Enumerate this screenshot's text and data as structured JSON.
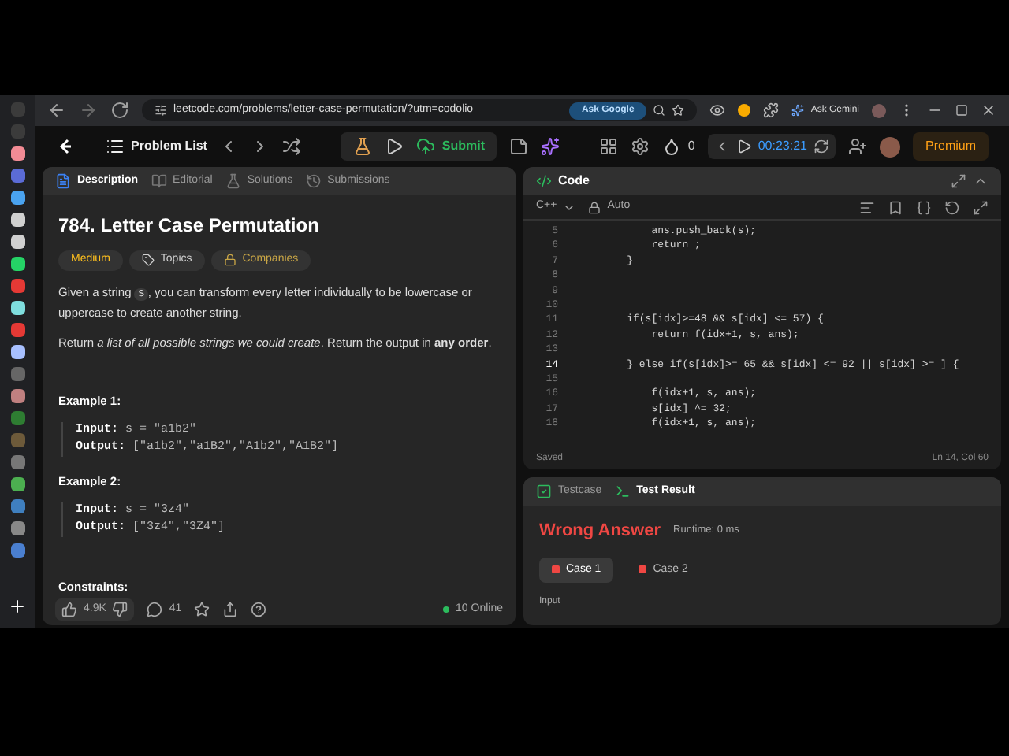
{
  "browser": {
    "url": "leetcode.com/problems/letter-case-permutation/?utm=codolio",
    "ask_google": "Ask Google",
    "ask_gemini": "Ask Gemini"
  },
  "header": {
    "problem_list": "Problem List",
    "submit": "Submit",
    "streak": "0",
    "timer": "00:23:21",
    "premium": "Premium"
  },
  "tabs": [
    {
      "label": "Description",
      "selected": true
    },
    {
      "label": "Editorial",
      "selected": false
    },
    {
      "label": "Solutions",
      "selected": false
    },
    {
      "label": "Submissions",
      "selected": false
    }
  ],
  "problem": {
    "title": "784. Letter Case Permutation",
    "tags": [
      {
        "label": "Medium",
        "kind": "difficulty"
      },
      {
        "label": "Topics",
        "kind": "topics"
      },
      {
        "label": "Companies",
        "kind": "companies"
      }
    ],
    "intro": {
      "before": "Given a string",
      "code": "s",
      "after": ", you can transform every letter individually to be lowercase or uppercase to create another string."
    },
    "task": "Return *a list of all possible strings we could create*. Return the output in **any order**.",
    "examples": [
      {
        "title": "Example 1:",
        "input_label": "Input:",
        "input": "s = \"a1b2\"",
        "output_label": "Output:",
        "output": "[\"a1b2\",\"a1B2\",\"A1b2\",\"A1B2\"]"
      },
      {
        "title": "Example 2:",
        "input_label": "Input:",
        "input": "s = \"3z4\"",
        "output_label": "Output:",
        "output": "[\"3z4\",\"3Z4\"]"
      }
    ],
    "constraints": "Constraints:"
  },
  "footer": {
    "likes": "4.9K",
    "comments": "41",
    "online": "10 Online"
  },
  "code": {
    "title": "Code",
    "language": "C++",
    "mode": "Auto",
    "lines": [
      {
        "number": "5",
        "text": "        ans.push_back(s);",
        "current": false
      },
      {
        "number": "6",
        "text": "        return ;",
        "current": false
      },
      {
        "number": "7",
        "text": "    }",
        "current": false
      },
      {
        "number": "8",
        "current": false
      },
      {
        "number": "9",
        "current": false
      },
      {
        "number": "10",
        "current": false
      },
      {
        "number": "11",
        "text": "    if(s[idx]>=48 && s[idx] <= 57) {",
        "current": false
      },
      {
        "number": "12",
        "text": "        return f(idx+1, s, ans);",
        "current": false
      },
      {
        "number": "13",
        "current": false
      },
      {
        "number": "14",
        "text": "    } else if(s[idx]>= 65 && s[idx] <= 92 || s[idx] >= ] {",
        "current": true
      },
      {
        "number": "15",
        "current": false
      },
      {
        "number": "16",
        "text": "        f(idx+1, s, ans);",
        "current": false
      },
      {
        "number": "17",
        "text": "        s[idx] ^= 32;",
        "current": false
      },
      {
        "number": "18",
        "text": "        f(idx+1, s, ans);",
        "current": false
      }
    ],
    "status": "Saved",
    "position": "Ln 14, Col 60"
  },
  "result": {
    "tabs": [
      {
        "label": "Testcase",
        "selected": false
      },
      {
        "label": "Test Result",
        "selected": true
      }
    ],
    "verdict": "Wrong Answer",
    "runtime": "Runtime: 0 ms",
    "cases": [
      {
        "label": "Case 1",
        "selected": true
      },
      {
        "label": "Case 2",
        "selected": false
      }
    ],
    "input_label": "Input"
  }
}
